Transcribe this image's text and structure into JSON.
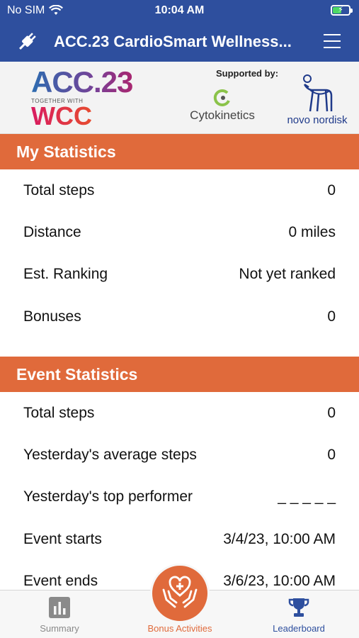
{
  "status_bar": {
    "carrier": "No SIM",
    "time": "10:04 AM"
  },
  "header": {
    "title": "ACC.23 CardioSmart Wellness..."
  },
  "banner": {
    "acc_logo": "ACC.23",
    "together_with": "TOGETHER WITH",
    "wcc_logo": "WCC",
    "supported_by": "Supported by:",
    "sponsor_1": "Cytokinetics",
    "sponsor_2": "novo nordisk"
  },
  "my_statistics": {
    "title": "My Statistics",
    "rows": [
      {
        "label": "Total steps",
        "value": "0"
      },
      {
        "label": "Distance",
        "value": "0 miles"
      },
      {
        "label": "Est. Ranking",
        "value": "Not yet ranked"
      },
      {
        "label": "Bonuses",
        "value": "0"
      }
    ]
  },
  "event_statistics": {
    "title": "Event Statistics",
    "rows": [
      {
        "label": "Total steps",
        "value": "0"
      },
      {
        "label": "Yesterday's average steps",
        "value": "0"
      },
      {
        "label": "Yesterday's top performer",
        "value": "_ _ _ _ _"
      },
      {
        "label": "Event starts",
        "value": "3/4/23, 10:00 AM"
      },
      {
        "label": "Event ends",
        "value": "3/6/23, 10:00 AM"
      }
    ]
  },
  "tabs": [
    {
      "label": "Summary",
      "icon": "bar-chart-icon"
    },
    {
      "label": "Bonus Activities",
      "icon": "heart-hands-icon"
    },
    {
      "label": "Leaderboard",
      "icon": "trophy-icon"
    }
  ],
  "colors": {
    "header_blue": "#2e4f9e",
    "accent_orange": "#e06a3b"
  }
}
